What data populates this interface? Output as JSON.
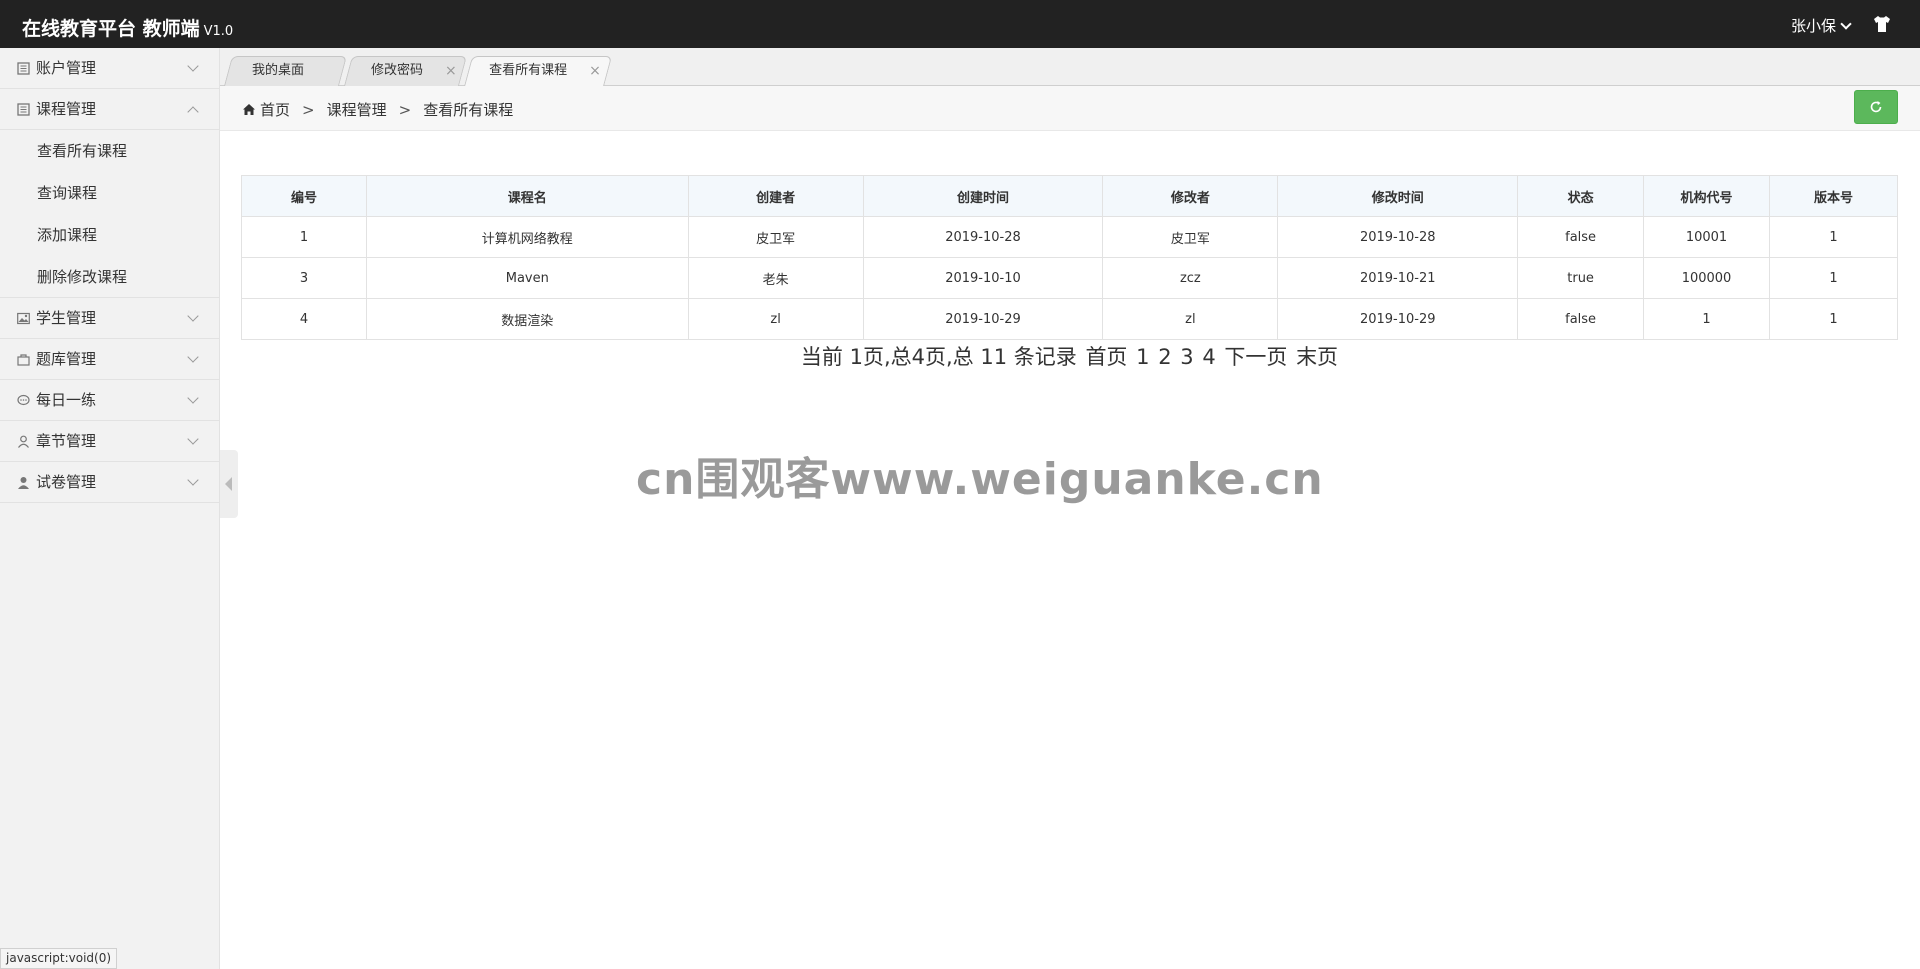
{
  "header": {
    "title": "在线教育平台 教师端",
    "version": "V1.0",
    "user_name": "张小保"
  },
  "sidebar": {
    "items": [
      {
        "label": "账户管理",
        "icon": "book-icon",
        "expanded": false
      },
      {
        "label": "课程管理",
        "icon": "book-icon",
        "expanded": true
      },
      {
        "label": "学生管理",
        "icon": "picture-icon",
        "expanded": false
      },
      {
        "label": "题库管理",
        "icon": "bag-icon",
        "expanded": false
      },
      {
        "label": "每日一练",
        "icon": "chat-icon",
        "expanded": false
      },
      {
        "label": "章节管理",
        "icon": "user-outline-icon",
        "expanded": false
      },
      {
        "label": "试卷管理",
        "icon": "user-icon",
        "expanded": false
      }
    ],
    "course_subitems": [
      "查看所有课程",
      "查询课程",
      "添加课程",
      "删除修改课程"
    ]
  },
  "tabs": [
    {
      "label": "我的桌面",
      "closable": false
    },
    {
      "label": "修改密码",
      "closable": true
    },
    {
      "label": "查看所有课程",
      "closable": true,
      "active": true
    }
  ],
  "breadcrumb": [
    "首页",
    "课程管理",
    "查看所有课程"
  ],
  "breadcrumb_sep": ">",
  "table": {
    "headers": [
      "编号",
      "课程名",
      "创建者",
      "创建时间",
      "修改者",
      "修改时间",
      "状态",
      "机构代号",
      "版本号"
    ],
    "rows": [
      [
        "1",
        "计算机网络教程",
        "皮卫军",
        "2019-10-28",
        "皮卫军",
        "2019-10-28",
        "false",
        "10001",
        "1"
      ],
      [
        "3",
        "Maven",
        "老朱",
        "2019-10-10",
        "zcz",
        "2019-10-21",
        "true",
        "100000",
        "1"
      ],
      [
        "4",
        "数据渲染",
        "zl",
        "2019-10-29",
        "zl",
        "2019-10-29",
        "false",
        "1",
        "1"
      ]
    ]
  },
  "pager": {
    "summary": "当前 1页,总4页,总 11 条记录",
    "first": "首页",
    "pages": [
      "1",
      "2",
      "3",
      "4"
    ],
    "next": "下一页",
    "last": "末页"
  },
  "watermark": "cn围观客www.weiguanke.cn",
  "status_bar": "javascript:void(0)",
  "colors": {
    "header_bg": "#222222",
    "refresh_button": "#5cb85c",
    "table_header_bg": "#f3f8fc"
  }
}
